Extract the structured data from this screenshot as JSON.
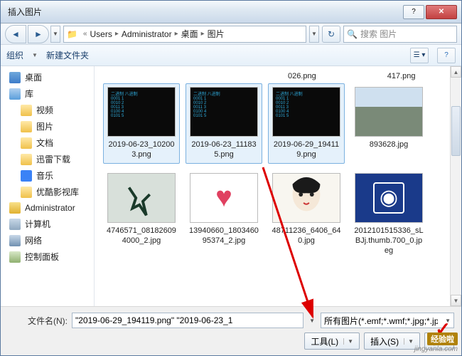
{
  "window": {
    "title": "插入图片"
  },
  "nav": {
    "path": [
      "Users",
      "Administrator",
      "桌面",
      "图片"
    ],
    "search_placeholder": "搜索 图片"
  },
  "toolbar": {
    "organize": "组织",
    "newfolder": "新建文件夹"
  },
  "sidebar": {
    "items": [
      {
        "label": "桌面",
        "cls": "desktop"
      },
      {
        "label": "库",
        "cls": "lib"
      },
      {
        "label": "视频",
        "cls": "folder",
        "sub": true
      },
      {
        "label": "图片",
        "cls": "folder",
        "sub": true
      },
      {
        "label": "文档",
        "cls": "folder",
        "sub": true
      },
      {
        "label": "迅雷下载",
        "cls": "folder",
        "sub": true
      },
      {
        "label": "音乐",
        "cls": "music",
        "sub": true
      },
      {
        "label": "优酷影视库",
        "cls": "folder",
        "sub": true
      },
      {
        "label": "Administrator",
        "cls": "user"
      },
      {
        "label": "计算机",
        "cls": "computer"
      },
      {
        "label": "网络",
        "cls": "network"
      },
      {
        "label": "控制面板",
        "cls": "control"
      }
    ]
  },
  "toprow": {
    "a": "026.png",
    "b": "417.png"
  },
  "files": [
    {
      "name": "2019-06-23_102003.png",
      "thumbcls": "dark",
      "selected": true
    },
    {
      "name": "2019-06-23_111835.png",
      "thumbcls": "dark",
      "selected": true
    },
    {
      "name": "2019-06-29_194119.png",
      "thumbcls": "dark",
      "selected": true
    },
    {
      "name": "893628.jpg",
      "thumbcls": "building",
      "selected": false
    },
    {
      "name": "4746571_081826094000_2.jpg",
      "thumbcls": "runner",
      "selected": false
    },
    {
      "name": "13940660_180346095374_2.jpg",
      "thumbcls": "tree",
      "selected": false
    },
    {
      "name": "48711236_6406_640.jpg",
      "thumbcls": "face",
      "selected": false
    },
    {
      "name": "2012101515336_sLBJj.thumb.700_0.jpeg",
      "thumbcls": "astro",
      "selected": false
    }
  ],
  "footer": {
    "filename_label": "文件名(N):",
    "filename_value": "\"2019-06-29_194119.png\" \"2019-06-23_1",
    "filter": "所有图片(*.emf;*.wmf;*.jpg;*.jpeg;*.jfif;*.jpe;*.png;*.bmp;*.gif;*.tif;*.tiff)",
    "tools": "工具(L)",
    "insert": "插入(S)",
    "cancel": "取消"
  },
  "watermark": {
    "l1": "经验啦",
    "l2": "jingyanla.com"
  }
}
